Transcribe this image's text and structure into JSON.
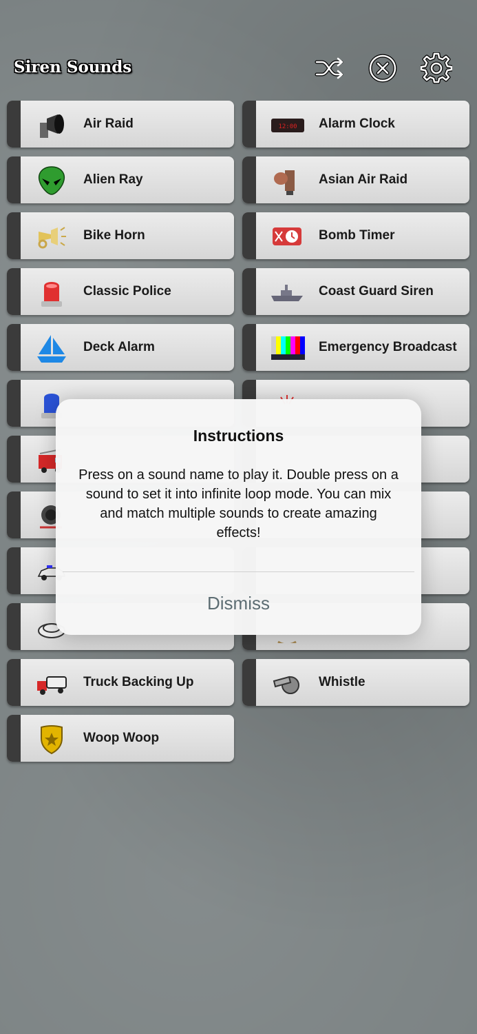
{
  "app": {
    "title": "Siren Sounds"
  },
  "header": {
    "shuffle_icon": "shuffle-icon",
    "stop_icon": "stop-circle-icon",
    "settings_icon": "gear-icon"
  },
  "sounds": [
    {
      "label": "Air Raid",
      "icon": "air-raid-siren-icon"
    },
    {
      "label": "Alarm Clock",
      "icon": "alarm-clock-icon"
    },
    {
      "label": "Alien Ray",
      "icon": "alien-icon"
    },
    {
      "label": "Asian Air Raid",
      "icon": "asian-siren-icon"
    },
    {
      "label": "Bike Horn",
      "icon": "bike-horn-icon"
    },
    {
      "label": "Bomb Timer",
      "icon": "bomb-timer-icon"
    },
    {
      "label": "Classic Police",
      "icon": "red-beacon-icon"
    },
    {
      "label": "Coast Guard Siren",
      "icon": "ship-icon"
    },
    {
      "label": "Deck Alarm",
      "icon": "sailboat-icon"
    },
    {
      "label": "Emergency Broadcast",
      "icon": "test-pattern-icon"
    },
    {
      "label": "",
      "icon": "blue-beacon-icon"
    },
    {
      "label": "",
      "icon": "red-alarm-icon"
    },
    {
      "label": "",
      "icon": "fire-truck-icon"
    },
    {
      "label": "",
      "icon": "hidden-icon"
    },
    {
      "label": "",
      "icon": "speaker-siren-icon"
    },
    {
      "label": "",
      "icon": "hidden-icon"
    },
    {
      "label": "",
      "icon": "police-car-icon"
    },
    {
      "label": "",
      "icon": "hidden-icon"
    },
    {
      "label": "",
      "icon": "smoke-detector-icon"
    },
    {
      "label": "",
      "icon": "bell-icon"
    },
    {
      "label": "Truck Backing Up",
      "icon": "truck-icon"
    },
    {
      "label": "Whistle",
      "icon": "whistle-icon"
    },
    {
      "label": "Woop Woop",
      "icon": "badge-icon"
    }
  ],
  "dialog": {
    "title": "Instructions",
    "message": "Press on a sound name to play it. Double press on a sound to set it into infinite loop mode. You can mix and match multiple sounds to create amazing effects!",
    "dismiss_label": "Dismiss"
  }
}
